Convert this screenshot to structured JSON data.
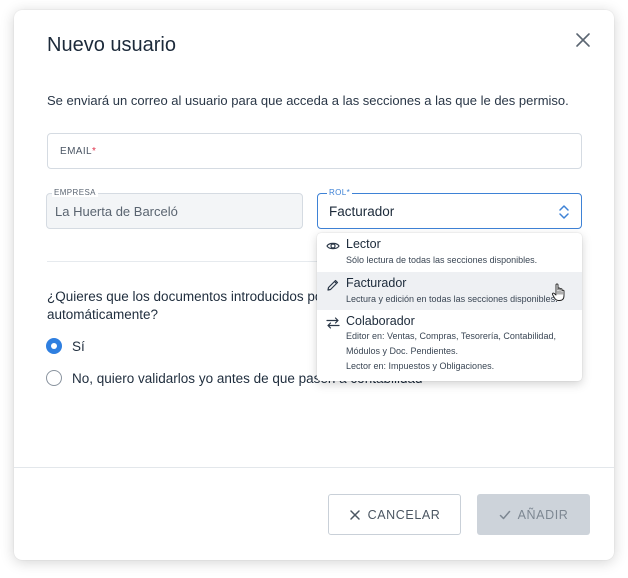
{
  "dialog": {
    "title": "Nuevo usuario",
    "description": "Se enviará un correo al usuario para que acceda a las secciones a las que le des permiso.",
    "close_icon": "close-icon"
  },
  "form": {
    "email": {
      "label": "EMAIL",
      "required_mark": "*",
      "value": ""
    },
    "empresa": {
      "label": "EMPRESA",
      "value": "La Huerta de Barceló"
    },
    "rol": {
      "label": "ROL",
      "required_mark": "*",
      "value": "Facturador",
      "focused_color": "#3e82d6"
    }
  },
  "rol_dropdown": {
    "options": [
      {
        "title": "Lector",
        "icon": "eye-icon",
        "desc": [
          "Sólo lectura de todas las secciones disponibles."
        ]
      },
      {
        "title": "Facturador",
        "icon": "pencil-icon",
        "desc": [
          "Lectura y edición en todas las secciones disponibles."
        ],
        "hovered": true
      },
      {
        "title": "Colaborador",
        "icon": "swap-arrows-icon",
        "desc": [
          "Editor en: Ventas, Compras, Tesorería, Contabilidad,",
          "Módulos y Doc. Pendientes.",
          "Lector en: Impuestos y Obligaciones."
        ]
      }
    ]
  },
  "validation": {
    "question_line1": "¿Quieres que los documentos introducidos por",
    "question_line2": "automáticamente?",
    "options": [
      {
        "label": "Sí",
        "checked": true
      },
      {
        "label": "No, quiero validarlos yo antes de que pasen a contabilidad",
        "checked": false
      }
    ]
  },
  "footer": {
    "cancel_label": "CANCELAR",
    "add_label": "AÑADIR",
    "add_disabled": true
  },
  "colors": {
    "accent": "#2f7fe0",
    "required": "#e0314b",
    "disabled_button": "#cdd3da"
  }
}
